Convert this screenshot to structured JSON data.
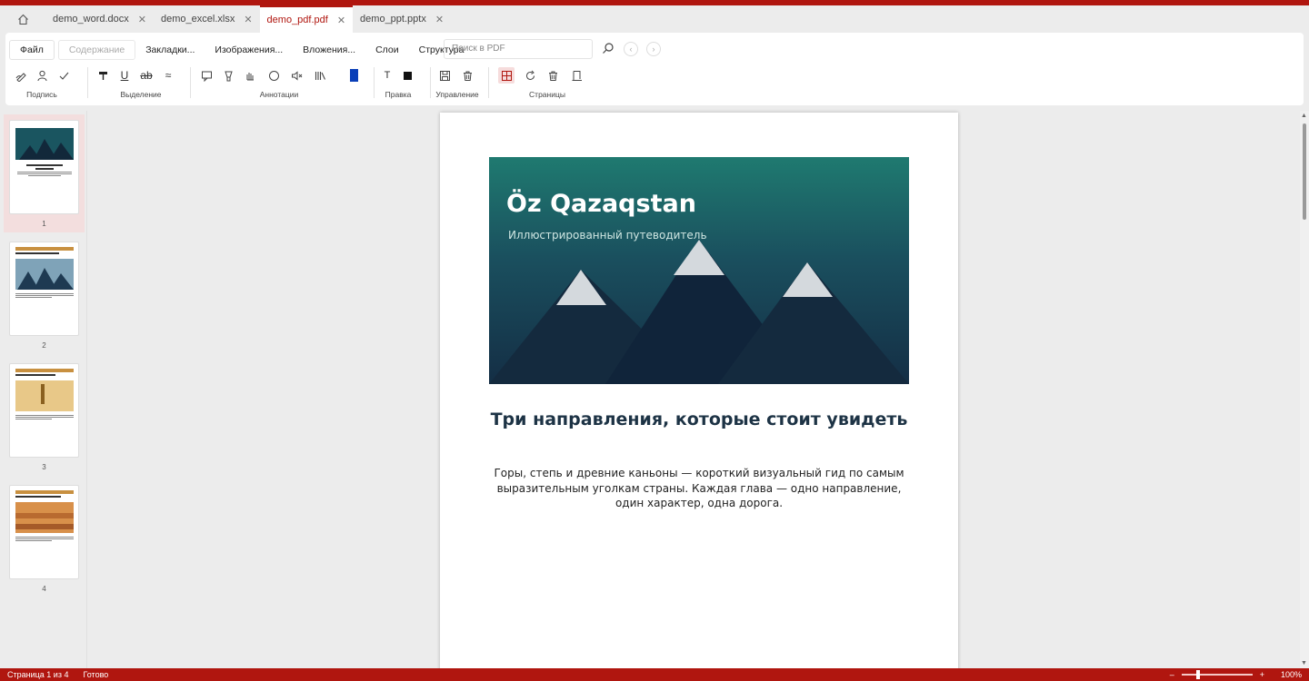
{
  "colors": {
    "accent": "#b0160f",
    "hero_top": "#1f7a70",
    "hero_bottom": "#142e45",
    "heading": "#1d3345"
  },
  "tabs": [
    {
      "label": "demo_word.docx",
      "active": false
    },
    {
      "label": "demo_excel.xlsx",
      "active": false
    },
    {
      "label": "demo_pdf.pdf",
      "active": true
    },
    {
      "label": "demo_ppt.pptx",
      "active": false
    }
  ],
  "menu": {
    "file": "Файл",
    "contents": "Содержание",
    "bookmarks": "Закладки...",
    "images": "Изображения...",
    "attachments": "Вложения...",
    "layers": "Слои",
    "structure": "Структура"
  },
  "search": {
    "placeholder": "Поиск в PDF"
  },
  "groups": {
    "signature": "Подпись",
    "selection": "Выделение",
    "annotations": "Аннотации",
    "edit": "Правка",
    "manage": "Управление",
    "pages": "Страницы"
  },
  "tools": {
    "text_tool": "T"
  },
  "thumbnails": [
    {
      "number": "1",
      "selected": true
    },
    {
      "number": "2",
      "selected": false
    },
    {
      "number": "3",
      "selected": false
    },
    {
      "number": "4",
      "selected": false
    }
  ],
  "page": {
    "hero_title": "Öz Qazaqstan",
    "hero_subtitle": "Иллюстрированный путеводитель",
    "heading": "Три направления, которые стоит увидеть",
    "paragraph": "Горы, степь и древние каньоны — короткий визуальный гид по самым выразительным уголкам страны. Каждая глава — одно направление, один характер, одна дорога."
  },
  "status": {
    "page_info": "Страница 1 из 4",
    "state": "Готово",
    "zoom": "100%",
    "zoom_minus": "–",
    "zoom_plus": "+"
  }
}
